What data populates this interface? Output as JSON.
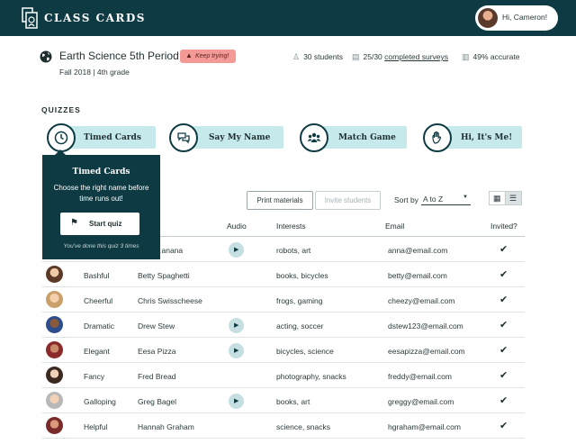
{
  "header": {
    "brand": "CLASS CARDS",
    "user_greeting": "Hi, Cameron!"
  },
  "class_info": {
    "title": "Earth Science 5th Period",
    "badge": "Keep trying!",
    "subtitle": "Fall 2018 | 4th grade",
    "stats": {
      "students": "30 students",
      "surveys_count": "25/30",
      "surveys_link": "completed surveys",
      "accuracy": "49% accurate"
    }
  },
  "quizzes": {
    "label": "QUIZZES",
    "items": [
      {
        "label": "Timed Cards",
        "icon": "clock-icon"
      },
      {
        "label": "Say My Name",
        "icon": "speech-bubbles-icon"
      },
      {
        "label": "Match Game",
        "icon": "group-icon"
      },
      {
        "label": "Hi, It's Me!",
        "icon": "hand-wave-icon"
      }
    ]
  },
  "popover": {
    "title": "Timed Cards",
    "description": "Choose the right name before time runs out!",
    "start_label": "Start quiz",
    "note": "You've done this quiz 3 times"
  },
  "toolbar": {
    "print_label": "Print materials",
    "invite_label": "Invite students",
    "sort_label": "Sort by",
    "sort_value": "A to Z"
  },
  "table": {
    "headers": {
      "audio": "Audio",
      "interests": "Interests",
      "email": "Email",
      "invited": "Invited?"
    },
    "rows": [
      {
        "adjective": "",
        "name": "…anana",
        "audio": true,
        "interests": "robots, art",
        "email": "anna@email.com",
        "invited": true
      },
      {
        "adjective": "Bashful",
        "name": "Betty Spaghetti",
        "audio": false,
        "interests": "books, bicycles",
        "email": "betty@email.com",
        "invited": true
      },
      {
        "adjective": "Cheerful",
        "name": "Chris Swisscheese",
        "audio": false,
        "interests": "frogs, gaming",
        "email": "cheezy@email.com",
        "invited": true
      },
      {
        "adjective": "Dramatic",
        "name": "Drew Stew",
        "audio": true,
        "interests": "acting, soccer",
        "email": "dstew123@email.com",
        "invited": true
      },
      {
        "adjective": "Elegant",
        "name": "Eesa Pizza",
        "audio": true,
        "interests": "bicycles, science",
        "email": "eesapizza@email.com",
        "invited": true
      },
      {
        "adjective": "Fancy",
        "name": "Fred Bread",
        "audio": false,
        "interests": "photography, snacks",
        "email": "freddy@email.com",
        "invited": true
      },
      {
        "adjective": "Galloping",
        "name": "Greg Bagel",
        "audio": true,
        "interests": "books, art",
        "email": "greggy@email.com",
        "invited": true
      },
      {
        "adjective": "Helpful",
        "name": "Hannah Graham",
        "audio": false,
        "interests": "science, snacks",
        "email": "hgraham@email.com",
        "invited": true
      }
    ]
  },
  "colors": {
    "brand_dark": "#0e3b43",
    "quiz_bar": "#c6eaec",
    "badge": "#f39a96"
  }
}
